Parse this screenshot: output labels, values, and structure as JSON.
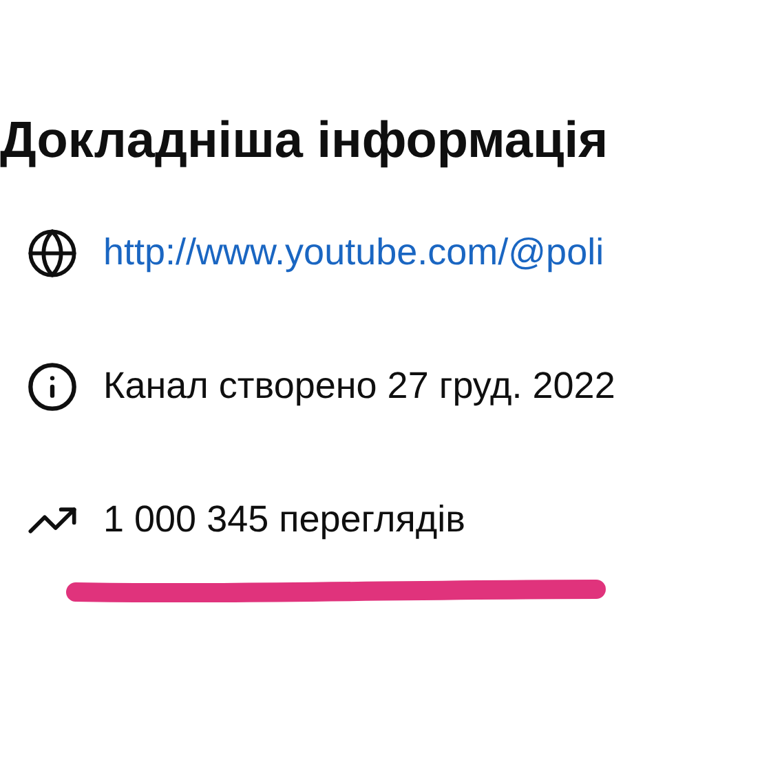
{
  "section": {
    "title": "Докладніша інформація"
  },
  "rows": [
    {
      "kind": "link",
      "text": "http://www.youtube.com/@poli"
    },
    {
      "kind": "info",
      "text": "Канал створено 27 груд. 2022"
    },
    {
      "kind": "views",
      "text": "1 000 345 переглядів"
    }
  ]
}
